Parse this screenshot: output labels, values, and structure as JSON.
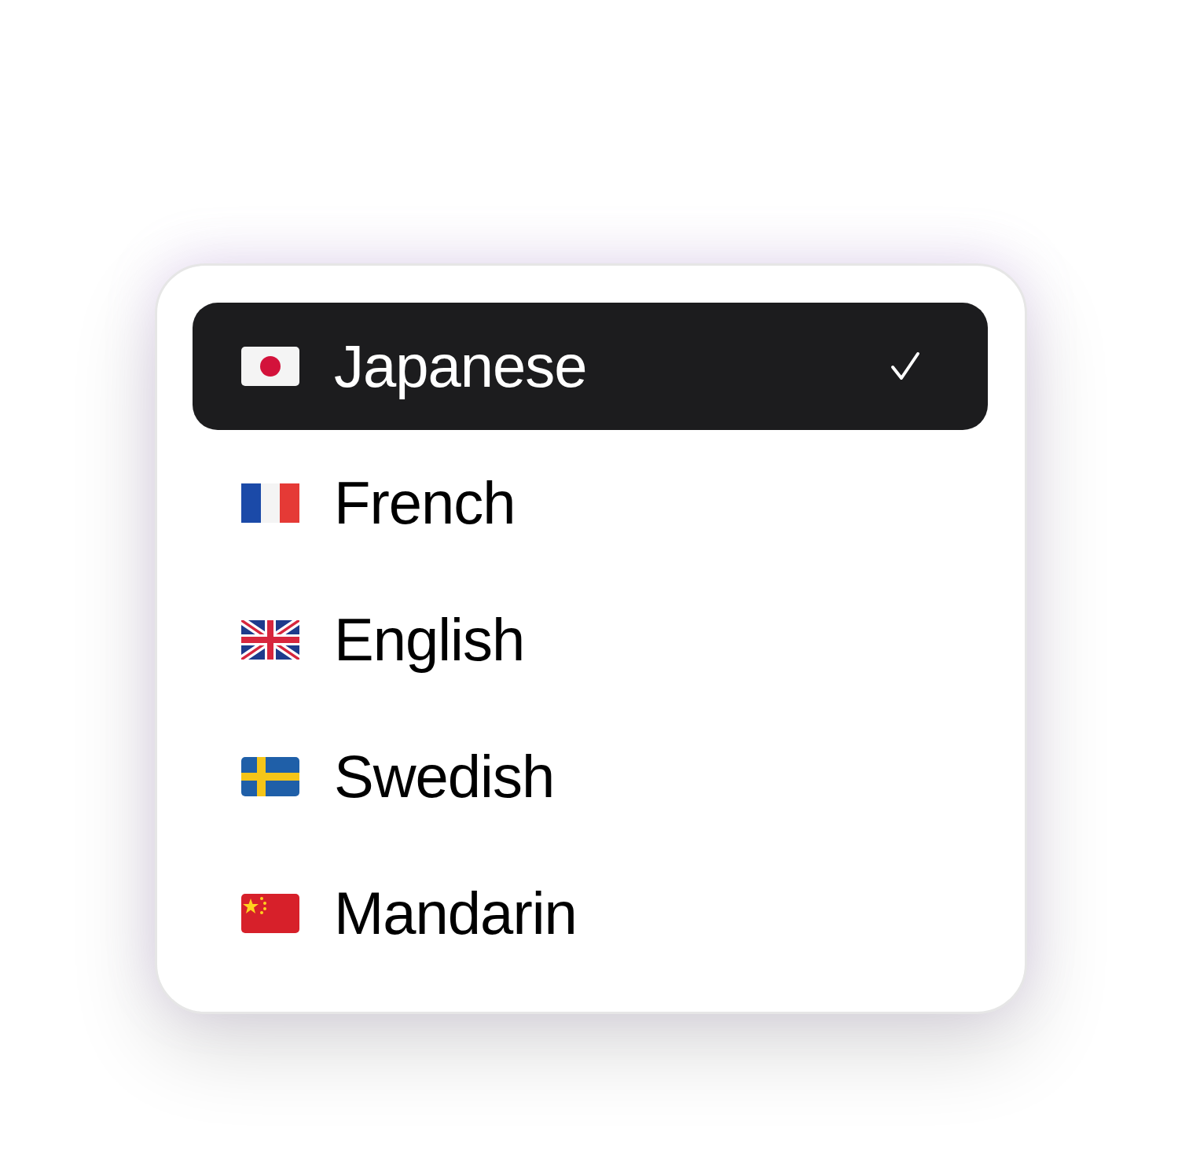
{
  "options": [
    {
      "kind": "japan",
      "label": "Japanese",
      "selected": true
    },
    {
      "kind": "france",
      "label": "French",
      "selected": false
    },
    {
      "kind": "uk",
      "label": "English",
      "selected": false
    },
    {
      "kind": "sweden",
      "label": "Swedish",
      "selected": false
    },
    {
      "kind": "china",
      "label": "Mandarin",
      "selected": false
    }
  ]
}
